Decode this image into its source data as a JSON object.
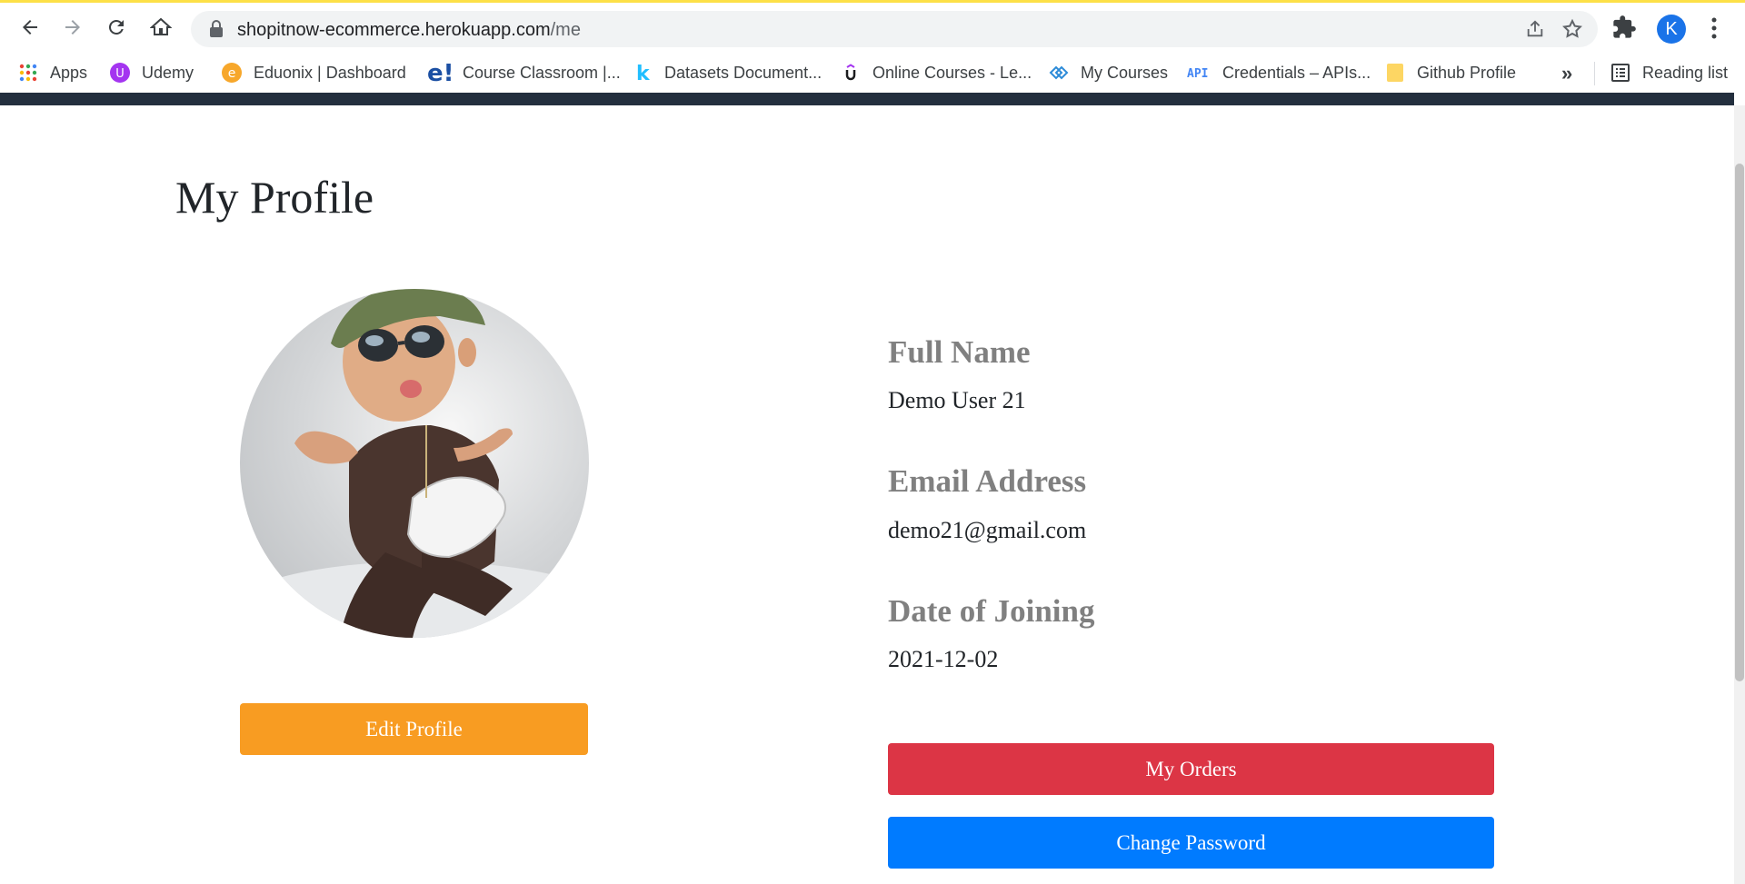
{
  "browser": {
    "url_host": "shopitnow-ecommerce.herokuapp.com",
    "url_path": "/me",
    "profile_initial": "K",
    "bookmarks": [
      {
        "label": "Apps",
        "icon": "apps-grid-icon"
      },
      {
        "label": "Udemy",
        "icon": "udemy-icon"
      },
      {
        "label": "Eduonix | Dashboard",
        "icon": "eduonix-icon"
      },
      {
        "label": "Course Classroom |...",
        "icon": "e-logo-icon"
      },
      {
        "label": "Datasets Document...",
        "icon": "k-logo-icon"
      },
      {
        "label": "Online Courses - Le...",
        "icon": "udemy-u-icon"
      },
      {
        "label": "My Courses",
        "icon": "diamond-logo-icon"
      },
      {
        "label": "Credentials – APIs...",
        "icon": "api-icon"
      },
      {
        "label": "Github Profile",
        "icon": "folder-icon"
      }
    ],
    "reading_list": "Reading list",
    "more_bookmarks": "»"
  },
  "colors": {
    "edit_button": "#f89c22",
    "orders_button": "#dc3545",
    "password_button": "#007bff",
    "header_bar": "#232f3e",
    "label_gray": "#808080"
  },
  "profile": {
    "title": "My Profile",
    "avatar_alt": "profile-photo",
    "edit_button": "Edit Profile",
    "fields": [
      {
        "label": "Full Name",
        "value": "Demo User 21"
      },
      {
        "label": "Email Address",
        "value": "demo21@gmail.com"
      },
      {
        "label": "Date of Joining",
        "value": "2021-12-02"
      }
    ],
    "orders_button": "My Orders",
    "password_button": "Change Password"
  }
}
